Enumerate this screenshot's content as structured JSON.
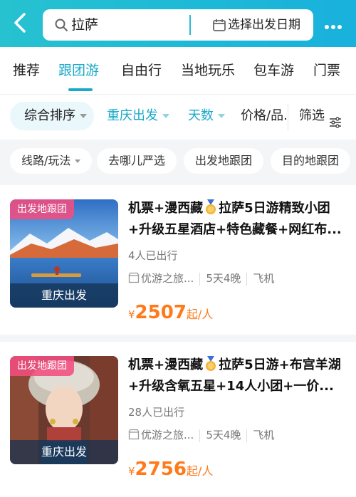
{
  "header": {
    "search_query": "拉萨",
    "date_button_label": "选择出发日期",
    "icons": {
      "back": "back-arrow-icon",
      "search": "search-icon",
      "calendar": "calendar-icon",
      "more": "more-icon"
    }
  },
  "tabs": [
    {
      "label": "推荐",
      "active": false
    },
    {
      "label": "跟团游",
      "active": true
    },
    {
      "label": "自由行",
      "active": false
    },
    {
      "label": "当地玩乐",
      "active": false
    },
    {
      "label": "包车游",
      "active": false
    },
    {
      "label": "门票",
      "active": false
    }
  ],
  "sortbar": {
    "sort_label": "综合排序",
    "departure_label": "重庆出发",
    "days_label": "天数",
    "price_label": "价格/品...",
    "filter_label": "筛选"
  },
  "chips": [
    {
      "label": "线路/玩法",
      "has_caret": true
    },
    {
      "label": "去哪儿严选",
      "has_caret": false
    },
    {
      "label": "出发地跟团",
      "has_caret": false
    },
    {
      "label": "目的地跟团",
      "has_caret": false
    }
  ],
  "products": [
    {
      "tag": "出发地跟团",
      "depart": "重庆出发",
      "title_before": "机票+漫西藏",
      "title_after": "拉萨5日游精致小团+升级五星酒店+特色藏餐+网红布...",
      "traveled": "4人已出行",
      "shop": "优游之旅...",
      "duration": "5天4晚",
      "transport": "飞机",
      "currency": "¥",
      "price": "2507",
      "price_unit": "起/人"
    },
    {
      "tag": "出发地跟团",
      "depart": "重庆出发",
      "title_before": "机票+漫西藏",
      "title_after": "拉萨5日游+布宫羊湖+升级含氧五星+14人小团+一价...",
      "traveled": "28人已出行",
      "shop": "优游之旅...",
      "duration": "5天4晚",
      "transport": "飞机",
      "currency": "¥",
      "price": "2756",
      "price_unit": "起/人"
    }
  ],
  "colors": {
    "header_gradient_start": "#27c2d0",
    "header_gradient_end": "#19b1dd",
    "accent": "#1aa9c8",
    "price": "#ff7a1a",
    "tag_pink": "#f14d80"
  }
}
